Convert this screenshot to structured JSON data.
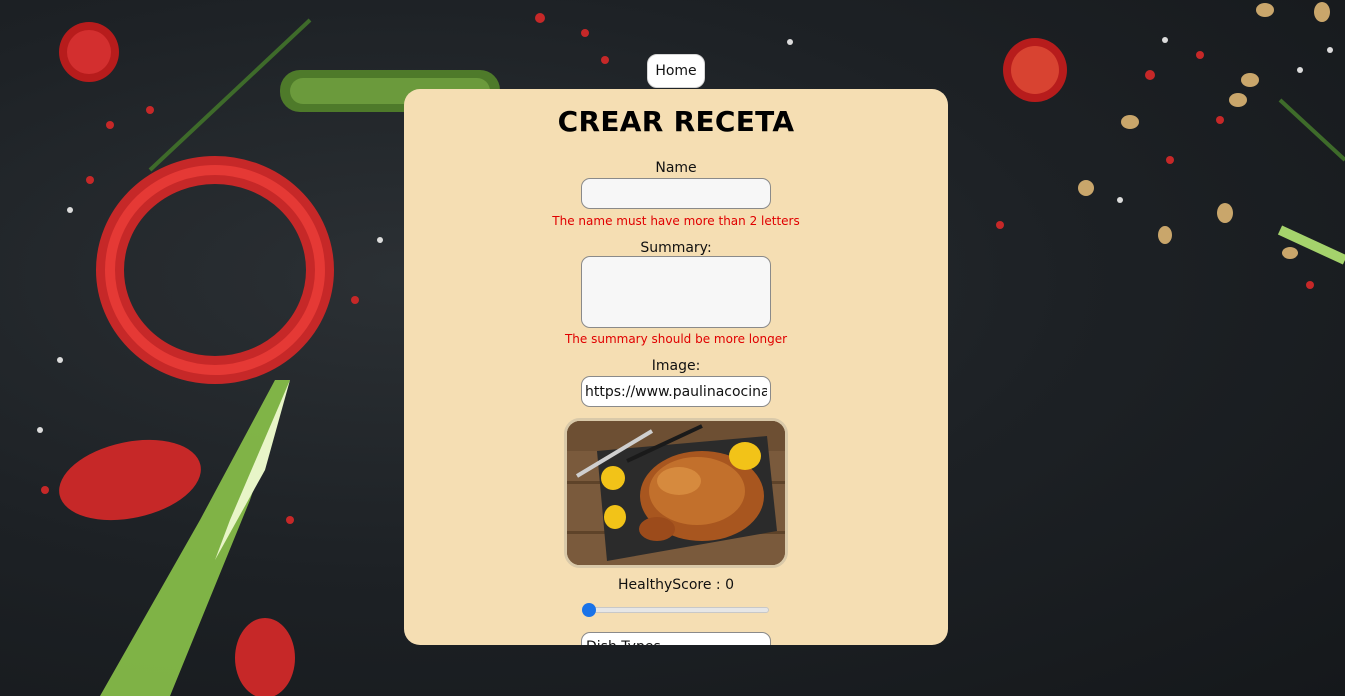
{
  "nav": {
    "home_label": "Home"
  },
  "form": {
    "title": "CREAR RECETA",
    "name": {
      "label": "Name",
      "value": "",
      "error": "The name must have more than 2 letters"
    },
    "summary": {
      "label": "Summary:",
      "value": "",
      "error": "The summary should be more longer"
    },
    "image": {
      "label": "Image:",
      "value": "https://www.paulinacocina.net"
    },
    "healthy_score": {
      "label": "HealthyScore : 0",
      "value": 0
    },
    "dish_types": {
      "label": "Dish Types"
    }
  },
  "colors": {
    "card_bg": "#f5deb3",
    "error": "#e00000",
    "slider_accent": "#1a73e8",
    "page_bg": "#1d2125"
  },
  "icons": [
    "roast-chicken-image",
    "vegetables-background"
  ]
}
